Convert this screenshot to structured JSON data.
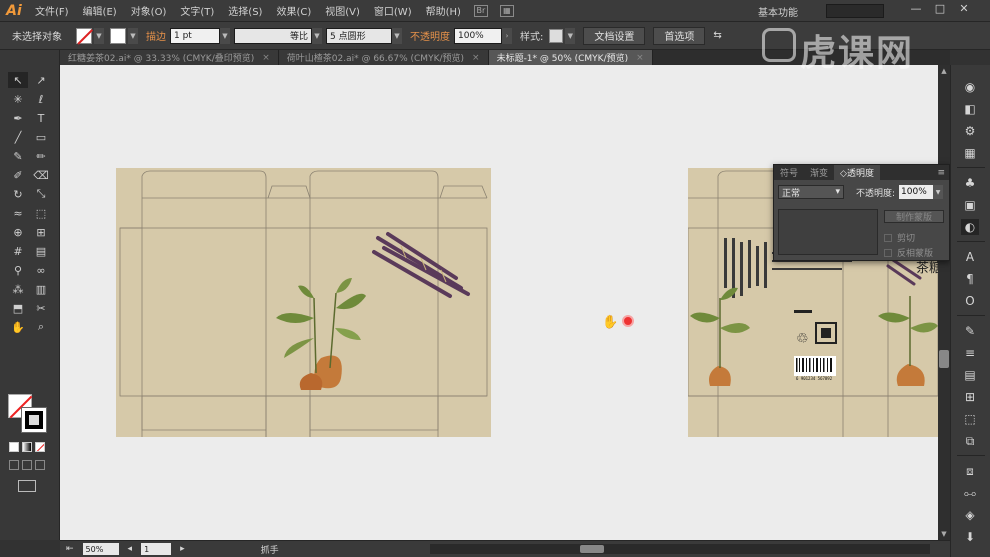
{
  "menubar": {
    "app_logo": "Ai",
    "items": [
      "文件(F)",
      "编辑(E)",
      "对象(O)",
      "文字(T)",
      "选择(S)",
      "效果(C)",
      "视图(V)",
      "窗口(W)",
      "帮助(H)"
    ],
    "icon_label": "Br",
    "workspace": "基本功能",
    "window_controls": [
      "—",
      "□",
      "✕"
    ]
  },
  "controlbar": {
    "no_selection": "未选择对象",
    "stroke_label": "描边",
    "stroke_weight": "1 pt",
    "stroke_profile": "等比",
    "brush": "5 点圆形",
    "opacity_label": "不透明度",
    "opacity_value": "100%",
    "style_label": "样式:",
    "doc_setup": "文档设置",
    "preferences": "首选项"
  },
  "tabs": [
    {
      "label": "红糖姜茶02.ai* @ 33.33% (CMYK/叠印预览)",
      "active": false
    },
    {
      "label": "荷叶山楂茶02.ai* @ 66.67% (CMYK/预览)",
      "active": false
    },
    {
      "label": "未标题-1* @ 50% (CMYK/预览)",
      "active": true
    }
  ],
  "tab_close": "×",
  "tools": [
    {
      "name": "selection-tool",
      "glyph": "↖"
    },
    {
      "name": "direct-selection-tool",
      "glyph": "↗"
    },
    {
      "name": "magic-wand-tool",
      "glyph": "✳"
    },
    {
      "name": "lasso-tool",
      "glyph": "ℓ"
    },
    {
      "name": "pen-tool",
      "glyph": "✒"
    },
    {
      "name": "type-tool",
      "glyph": "T"
    },
    {
      "name": "line-tool",
      "glyph": "╱"
    },
    {
      "name": "rectangle-tool",
      "glyph": "▭"
    },
    {
      "name": "paintbrush-tool",
      "glyph": "✎"
    },
    {
      "name": "pencil-tool",
      "glyph": "✏"
    },
    {
      "name": "blob-brush-tool",
      "glyph": "✐"
    },
    {
      "name": "eraser-tool",
      "glyph": "⌫"
    },
    {
      "name": "rotate-tool",
      "glyph": "↻"
    },
    {
      "name": "scale-tool",
      "glyph": "⤡"
    },
    {
      "name": "warp-tool",
      "glyph": "≈"
    },
    {
      "name": "free-transform-tool",
      "glyph": "⬚"
    },
    {
      "name": "shape-builder-tool",
      "glyph": "⊕"
    },
    {
      "name": "perspective-grid-tool",
      "glyph": "⊞"
    },
    {
      "name": "mesh-tool",
      "glyph": "#"
    },
    {
      "name": "gradient-tool",
      "glyph": "▤"
    },
    {
      "name": "eyedropper-tool",
      "glyph": "⚲"
    },
    {
      "name": "blend-tool",
      "glyph": "∞"
    },
    {
      "name": "symbol-sprayer-tool",
      "glyph": "⁂"
    },
    {
      "name": "column-graph-tool",
      "glyph": "▥"
    },
    {
      "name": "artboard-tool",
      "glyph": "⬒"
    },
    {
      "name": "slice-tool",
      "glyph": "✂"
    },
    {
      "name": "hand-tool",
      "glyph": "✋"
    },
    {
      "name": "zoom-tool",
      "glyph": "⌕"
    }
  ],
  "transparency_panel": {
    "tabs": [
      "符号",
      "渐变",
      "◇透明度"
    ],
    "active_tab": 2,
    "menu": "≡",
    "blend_mode": "正常",
    "opacity_label": "不透明度:",
    "opacity_value": "100%",
    "make_mask": "制作蒙版",
    "clip": "剪切",
    "invert_mask": "反相蒙版"
  },
  "statusbar": {
    "zoom": "50%",
    "artboard": "1",
    "tool_name": "抓手"
  },
  "artwork": {
    "box_color": "#d6c9a9",
    "dieline_color": "#8a8170",
    "barcode_digits": "6 901234 567892",
    "side_text": "茶糖"
  },
  "watermark": "虎课网",
  "colors": {
    "accent_orange": "#e5914a",
    "canvas_bg": "#ececec"
  }
}
